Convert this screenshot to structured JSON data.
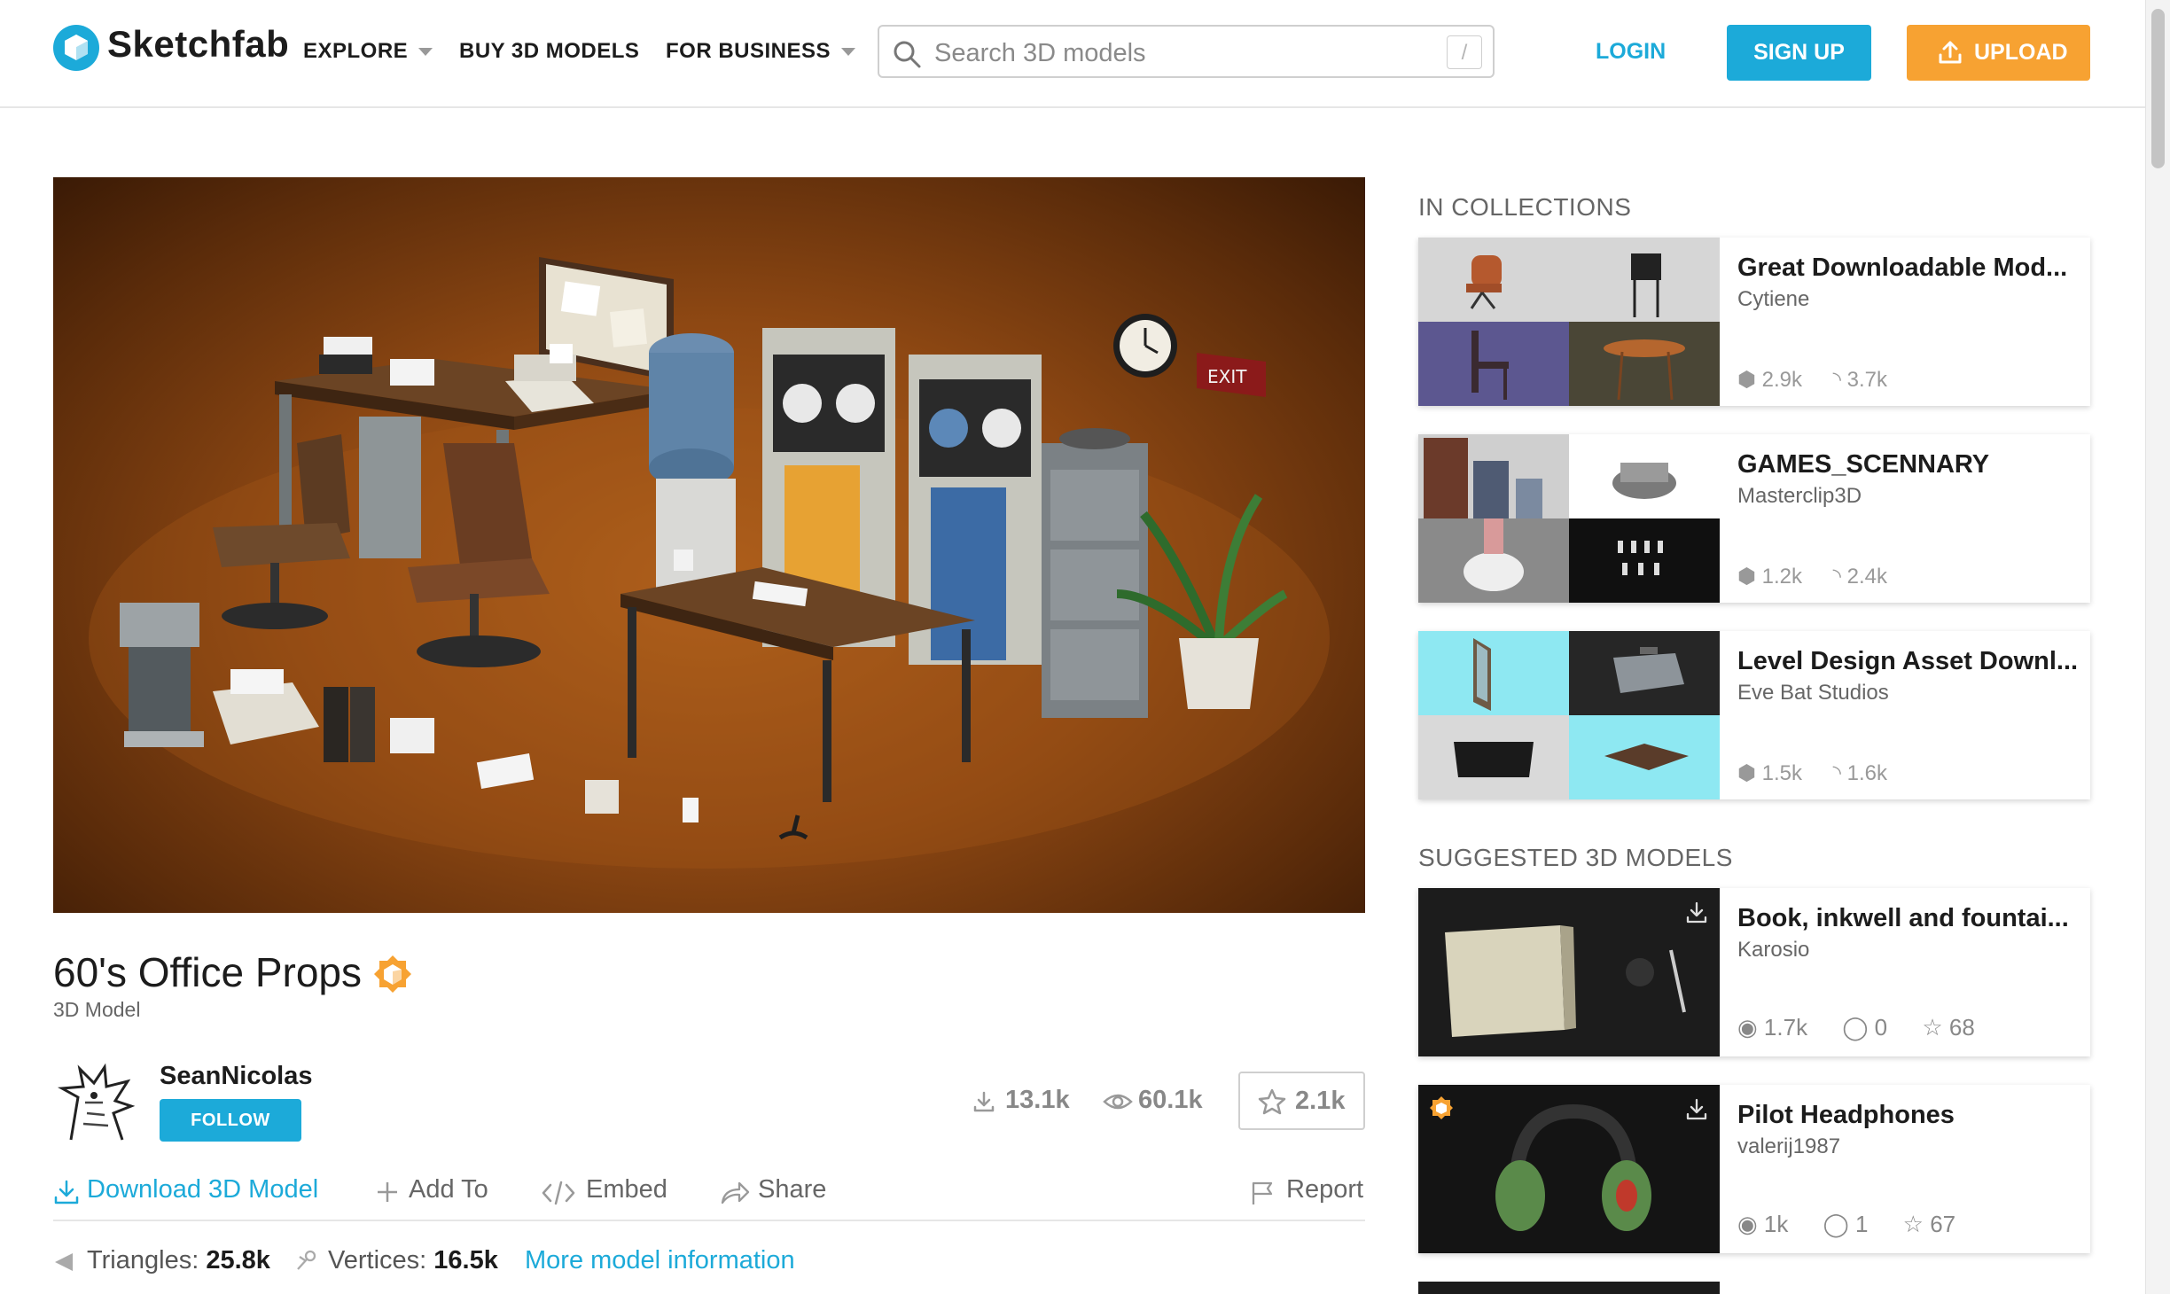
{
  "header": {
    "brand": "Sketchfab",
    "nav": [
      {
        "label": "EXPLORE",
        "dropdown": true
      },
      {
        "label": "BUY 3D MODELS",
        "dropdown": false
      },
      {
        "label": "FOR BUSINESS",
        "dropdown": true
      }
    ],
    "search_placeholder": "Search 3D models",
    "search_shortcut": "/",
    "login": "LOGIN",
    "signup": "SIGN UP",
    "upload": "UPLOAD"
  },
  "colors": {
    "accent": "#1caad9",
    "upload": "#f7a232",
    "staff_pick": "#f7a232"
  },
  "model": {
    "title": "60's Office Props",
    "subtitle": "3D Model",
    "author": "SeanNicolas",
    "follow": "FOLLOW",
    "downloads": "13.1k",
    "views": "60.1k",
    "likes": "2.1k",
    "actions": {
      "download": "Download 3D Model",
      "add_to": "Add To",
      "embed": "Embed",
      "share": "Share",
      "report": "Report"
    },
    "meta": {
      "triangles_label": "Triangles:",
      "triangles": "25.8k",
      "vertices_label": "Vertices:",
      "vertices": "16.5k",
      "more": "More model information"
    }
  },
  "collections": {
    "heading": "IN COLLECTIONS",
    "items": [
      {
        "title": "Great Downloadable Mod...",
        "author": "Cytiene",
        "models": "2.9k",
        "followers": "3.7k"
      },
      {
        "title": "GAMES_SCENNARY",
        "author": "Masterclip3D",
        "models": "1.2k",
        "followers": "2.4k"
      },
      {
        "title": "Level Design Asset Downl...",
        "author": "Eve Bat Studios",
        "models": "1.5k",
        "followers": "1.6k"
      }
    ]
  },
  "suggested": {
    "heading": "SUGGESTED 3D MODELS",
    "items": [
      {
        "title": "Book, inkwell and fountai...",
        "author": "Karosio",
        "views": "1.7k",
        "comments": "0",
        "likes": "68",
        "staff_pick": false
      },
      {
        "title": "Pilot Headphones",
        "author": "valerij1987",
        "views": "1k",
        "comments": "1",
        "likes": "67",
        "staff_pick": true
      }
    ]
  }
}
